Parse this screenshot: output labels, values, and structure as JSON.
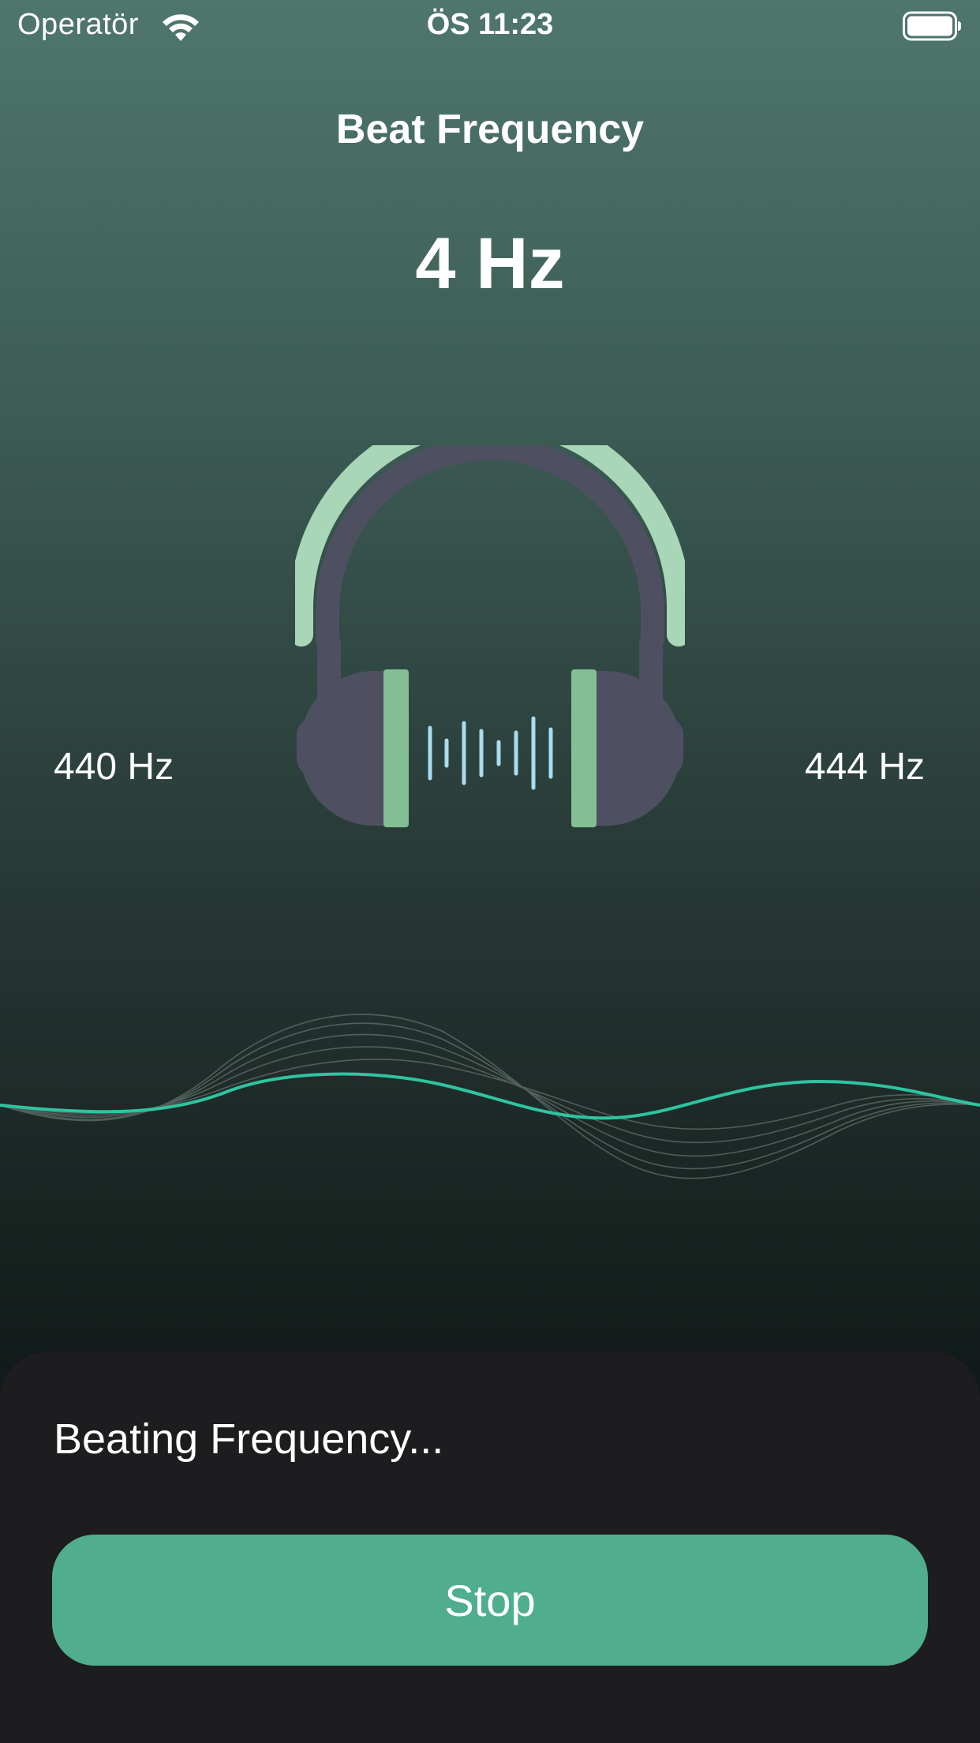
{
  "status_bar": {
    "carrier": "Operatör",
    "time": "ÖS 11:23",
    "wifi_icon": "wifi-icon",
    "battery_icon": "battery-full-icon"
  },
  "header": {
    "title": "Beat Frequency",
    "beat_value": "4 Hz"
  },
  "channels": {
    "left_frequency": "440 Hz",
    "right_frequency": "444 Hz"
  },
  "illustration": {
    "icon": "headphones-icon",
    "wave_icon": "sine-wave-icon"
  },
  "sheet": {
    "status_text": "Beating Frequency...",
    "stop_label": "Stop"
  },
  "colors": {
    "accent": "#50ae8e",
    "sheet_background": "#1d1d1f",
    "headband_top": "#a9d6b7",
    "headphone_body": "#4e5061",
    "ear_pad": "#84bf93",
    "sound_bars": "#a9dcee",
    "wave_line": "#2ec4a0"
  }
}
